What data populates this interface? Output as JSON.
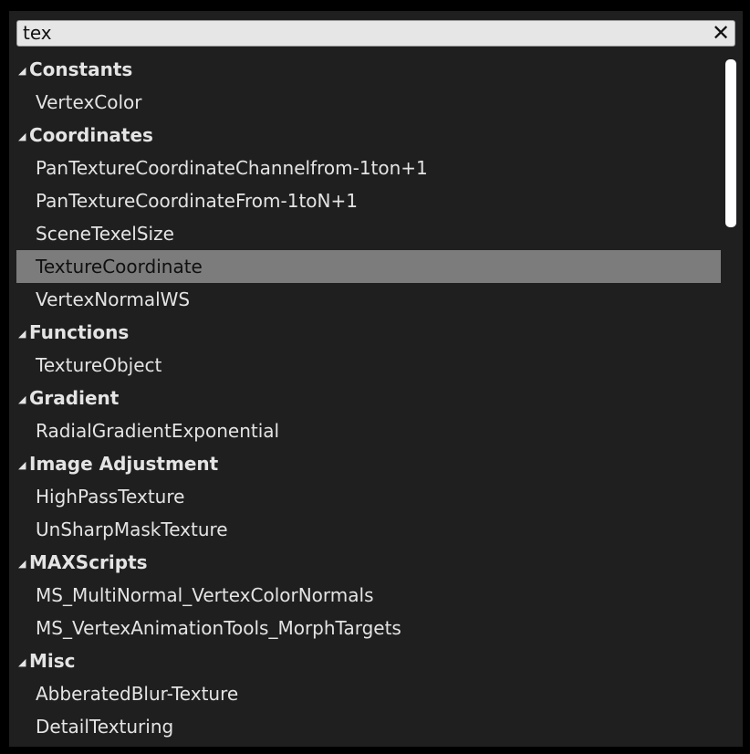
{
  "search": {
    "value": "tex",
    "clear_label": "✕"
  },
  "list": {
    "groups": [
      {
        "category": "Constants",
        "items": [
          "VertexColor"
        ]
      },
      {
        "category": "Coordinates",
        "items": [
          "PanTextureCoordinateChannelfrom-1ton+1",
          "PanTextureCoordinateFrom-1toN+1",
          "SceneTexelSize",
          "TextureCoordinate",
          "VertexNormalWS"
        ]
      },
      {
        "category": "Functions",
        "items": [
          "TextureObject"
        ]
      },
      {
        "category": "Gradient",
        "items": [
          "RadialGradientExponential"
        ]
      },
      {
        "category": "Image Adjustment",
        "items": [
          "HighPassTexture",
          "UnSharpMaskTexture"
        ]
      },
      {
        "category": "MAXScripts",
        "items": [
          "MS_MultiNormal_VertexColorNormals",
          "MS_VertexAnimationTools_MorphTargets"
        ]
      },
      {
        "category": "Misc",
        "items": [
          "AbberatedBlur-Texture",
          "DetailTexturing"
        ]
      }
    ],
    "selected_item": "TextureCoordinate",
    "caret_glyph": "◢"
  },
  "colors": {
    "panel_background": "#1f1f1f",
    "selected_row": "#7c7c7c",
    "search_background": "#e6e6e6"
  }
}
